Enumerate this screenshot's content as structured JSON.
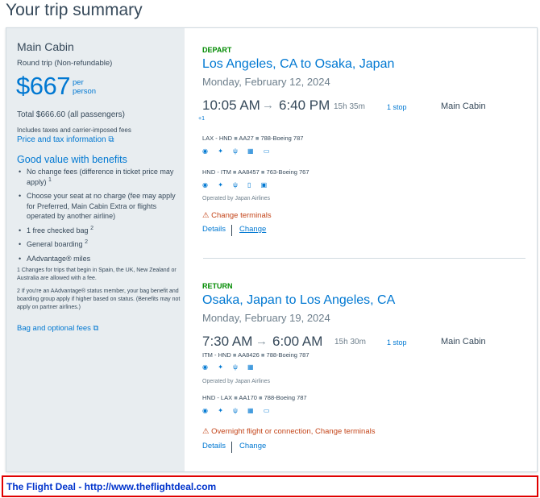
{
  "page": {
    "title": "Your trip summary"
  },
  "summary": {
    "cabin": "Main Cabin",
    "trip_type": "Round trip (Non-refundable)",
    "price": "$667",
    "per_line1": "per",
    "per_line2": "person",
    "total": "Total $666.60 (all passengers)",
    "includes": "Includes taxes and carrier-imposed fees",
    "price_tax_link": "Price and tax information ⧉",
    "good_value_title": "Good value with benefits",
    "benefits": [
      {
        "text": "No change fees (difference in ticket price may apply)",
        "sup": "1"
      },
      {
        "text": "Choose your seat at no charge (fee may apply for Preferred, Main Cabin Extra or flights operated by another airline)",
        "sup": ""
      },
      {
        "text": "1 free checked bag",
        "sup": "2"
      },
      {
        "text": "General boarding",
        "sup": "2"
      },
      {
        "text": "AAdvantage® miles",
        "sup": ""
      }
    ],
    "footnote1": "1 Changes for trips that begin in Spain, the UK, New Zealand or Australia are allowed with a fee.",
    "footnote2": "2 If you're an AAdvantage® status member, your bag benefit and boarding group apply if higher based on status. (Benefits may not apply on partner airlines.)",
    "bag_fees_link": "Bag and optional fees ⧉"
  },
  "depart": {
    "label": "DEPART",
    "route": "Los Angeles, CA to Osaka, Japan",
    "date": "Monday, February 12, 2024",
    "dep_time": "10:05 AM",
    "arrow": "→",
    "arr_time": "6:40 PM",
    "duration": "15h 35m",
    "stops": "1 stop",
    "cabin": "Main Cabin",
    "plus_day": "+1",
    "segments": [
      {
        "route": "LAX - HND",
        "flight": "AA27",
        "aircraft": "788-Boeing 787",
        "amenities": "◉ ✦ ψ ▦ ▭",
        "operated": ""
      },
      {
        "route": "HND - ITM",
        "flight": "AA8457",
        "aircraft": "763-Boeing 767",
        "amenities": "◉ ✦ ψ ▯ ▣",
        "operated": "Operated by Japan Airlines"
      }
    ],
    "warning": "⚠ Change terminals",
    "details": "Details",
    "change": "Change"
  },
  "return": {
    "label": "RETURN",
    "route": "Osaka, Japan to Los Angeles, CA",
    "date": "Monday, February 19, 2024",
    "dep_time": "7:30 AM",
    "arrow": "→",
    "arr_time": "6:00 AM",
    "duration": "15h 30m",
    "stops": "1 stop",
    "cabin": "Main Cabin",
    "segments": [
      {
        "route": "ITM - HND",
        "flight": "AA8426",
        "aircraft": "788-Boeing 787",
        "amenities": "◉ ✦ ψ ▦",
        "operated": "Operated by Japan Airlines"
      },
      {
        "route": "HND - LAX",
        "flight": "AA170",
        "aircraft": "788-Boeing 787",
        "amenities": "◉ ✦ ψ ▦ ▭",
        "operated": ""
      }
    ],
    "warning": "⚠ Overnight flight or connection, Change terminals",
    "details": "Details",
    "change": "Change"
  },
  "footer": {
    "text": "The Flight Deal - http://www.theflightdeal.com"
  }
}
